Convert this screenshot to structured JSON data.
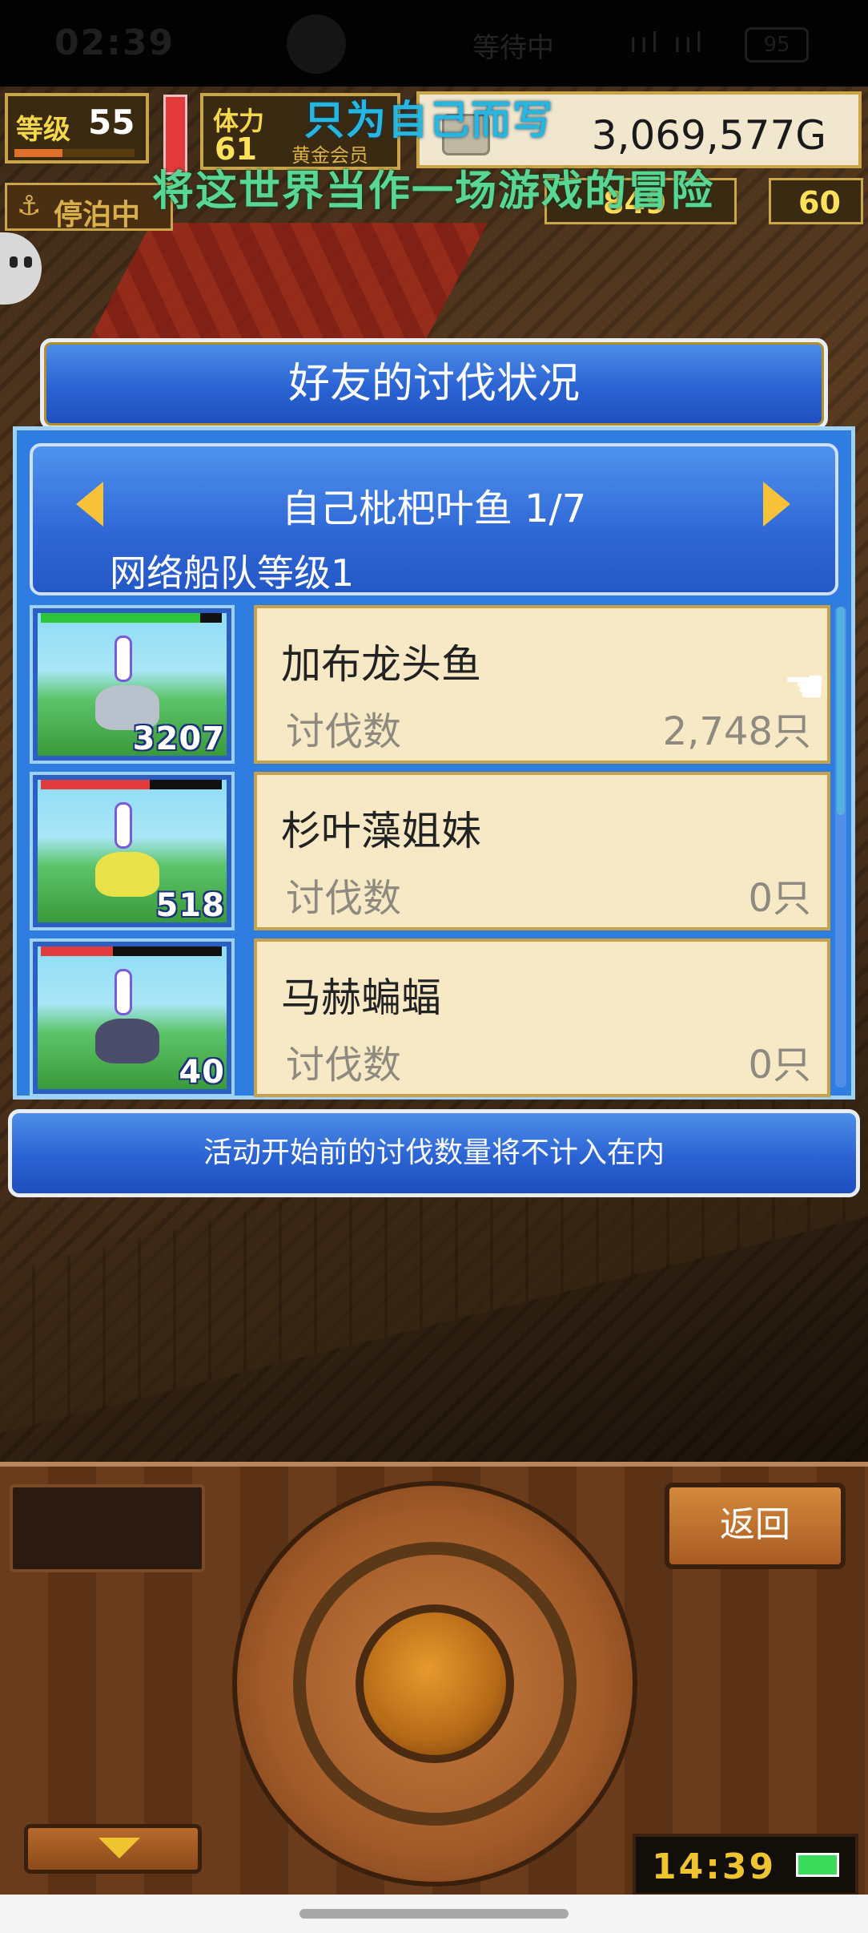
{
  "status_bar": {
    "time": "02:39",
    "center_text": "等待中",
    "signal": "ııl ııl",
    "battery": "95"
  },
  "hud": {
    "level_label": "等级",
    "level_value": "55",
    "stamina_label": "体力",
    "stamina_value": "61",
    "stamina_sub": "黄金会员",
    "gold": "3,069,577G",
    "anchor_label": "停泊中",
    "resource_value": "849",
    "right_value": "60"
  },
  "overlay": {
    "line1": "只为自己而写",
    "line2": "将这世界当作一场游戏的冒险"
  },
  "panel": {
    "title": "好友的讨伐状况",
    "friend_name": "自己枇杷叶鱼 1/7",
    "fleet_level": "网络船队等级1",
    "kill_label": "讨伐数",
    "rows": [
      {
        "monster": "加布龙头鱼",
        "kills": "2,748只",
        "count": "3207",
        "hp": 0.88,
        "hp_color": "#2ec43a",
        "monster_color": "#b9c2cc"
      },
      {
        "monster": "杉叶藻姐妹",
        "kills": "0只",
        "count": "518",
        "hp": 0.6,
        "hp_color": "#e33b3b",
        "monster_color": "#e8e24a"
      },
      {
        "monster": "马赫蝙蝠",
        "kills": "0只",
        "count": "40",
        "hp": 0.4,
        "hp_color": "#e33b3b",
        "monster_color": "#4a4e6a"
      }
    ],
    "footer_note": "活动开始前的讨伐数量将不计入在内"
  },
  "console": {
    "back_label": "返回",
    "clock": "14:39"
  }
}
